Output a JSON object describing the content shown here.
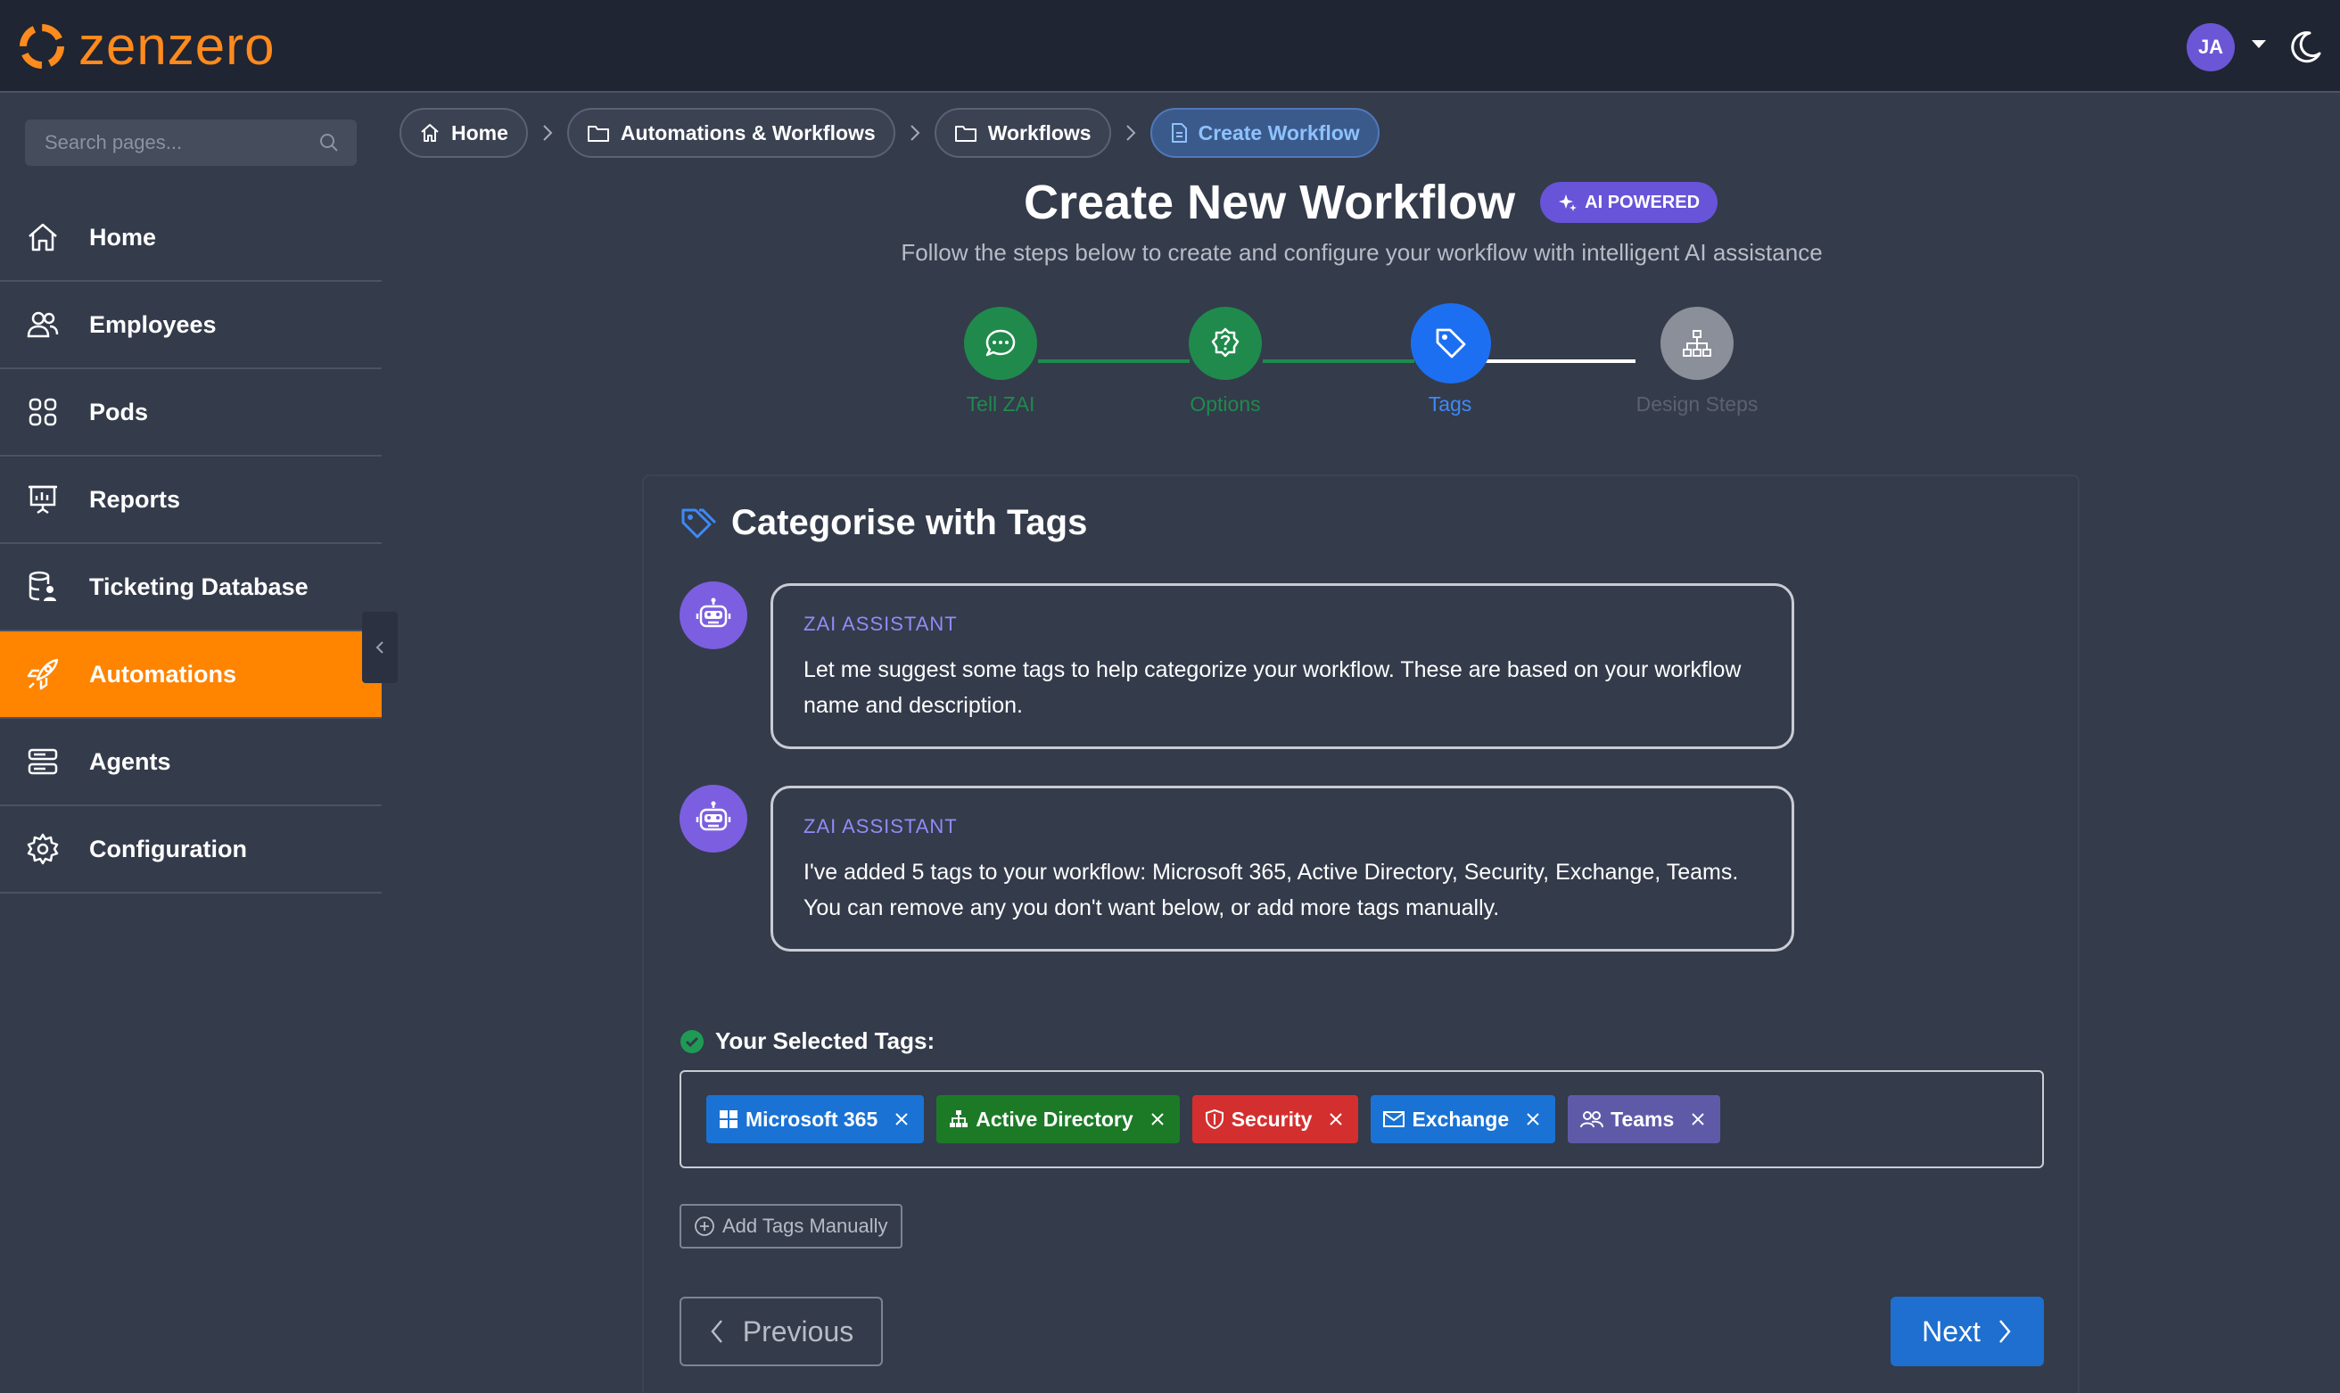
{
  "app": {
    "logo_text": "zenzero",
    "brand_color": "#ff8a1d"
  },
  "header": {
    "avatar_initials": "JA"
  },
  "sidebar": {
    "search_placeholder": "Search pages...",
    "items": [
      {
        "label": "Home",
        "icon": "home-icon"
      },
      {
        "label": "Employees",
        "icon": "users-icon"
      },
      {
        "label": "Pods",
        "icon": "grid-icon"
      },
      {
        "label": "Reports",
        "icon": "presentation-icon"
      },
      {
        "label": "Ticketing Database",
        "icon": "database-user-icon"
      },
      {
        "label": "Automations",
        "icon": "rocket-icon",
        "active": true
      },
      {
        "label": "Agents",
        "icon": "server-icon"
      },
      {
        "label": "Configuration",
        "icon": "gear-icon"
      }
    ]
  },
  "breadcrumb": [
    {
      "label": "Home",
      "icon": "home-icon"
    },
    {
      "label": "Automations & Workflows",
      "icon": "folder-icon"
    },
    {
      "label": "Workflows",
      "icon": "folder-icon"
    },
    {
      "label": "Create Workflow",
      "icon": "document-icon",
      "current": true
    }
  ],
  "page": {
    "title": "Create New Workflow",
    "badge": "AI POWERED",
    "subtitle": "Follow the steps below to create and configure your workflow with intelligent AI assistance"
  },
  "steps": [
    {
      "label": "Tell ZAI",
      "status": "complete",
      "icon": "chat-icon"
    },
    {
      "label": "Options",
      "status": "complete",
      "icon": "question-icon"
    },
    {
      "label": "Tags",
      "status": "current",
      "icon": "tag-icon"
    },
    {
      "label": "Design Steps",
      "status": "pending",
      "icon": "sitemap-icon"
    }
  ],
  "section": {
    "title": "Categorise with Tags",
    "messages": [
      {
        "sender": "ZAI ASSISTANT",
        "line1": "Let me suggest some tags to help categorize your workflow. These are based on your workflow",
        "line2": "name and description."
      },
      {
        "sender": "ZAI ASSISTANT",
        "line1": "I've added 5 tags to your workflow: Microsoft 365, Active Directory, Security, Exchange, Teams.",
        "line2": "You can remove any you don't want below, or add more tags manually."
      }
    ],
    "selected_label": "Your Selected Tags:",
    "tags": [
      {
        "label": "Microsoft 365",
        "color": "#1a73d4",
        "icon": "windows-icon"
      },
      {
        "label": "Active Directory",
        "color": "#1c7a27",
        "icon": "sitemap-icon"
      },
      {
        "label": "Security",
        "color": "#d42f2f",
        "icon": "shield-icon"
      },
      {
        "label": "Exchange",
        "color": "#1a73d4",
        "icon": "envelope-icon"
      },
      {
        "label": "Teams",
        "color": "#5f5aa8",
        "icon": "people-icon"
      }
    ],
    "add_manual_label": "Add Tags Manually",
    "previous_label": "Previous",
    "next_label": "Next"
  },
  "colors": {
    "step_complete": "#1f8a4c",
    "step_current": "#1d6ff2",
    "step_pending": "#8a8f99",
    "active_nav": "#ff8400"
  }
}
